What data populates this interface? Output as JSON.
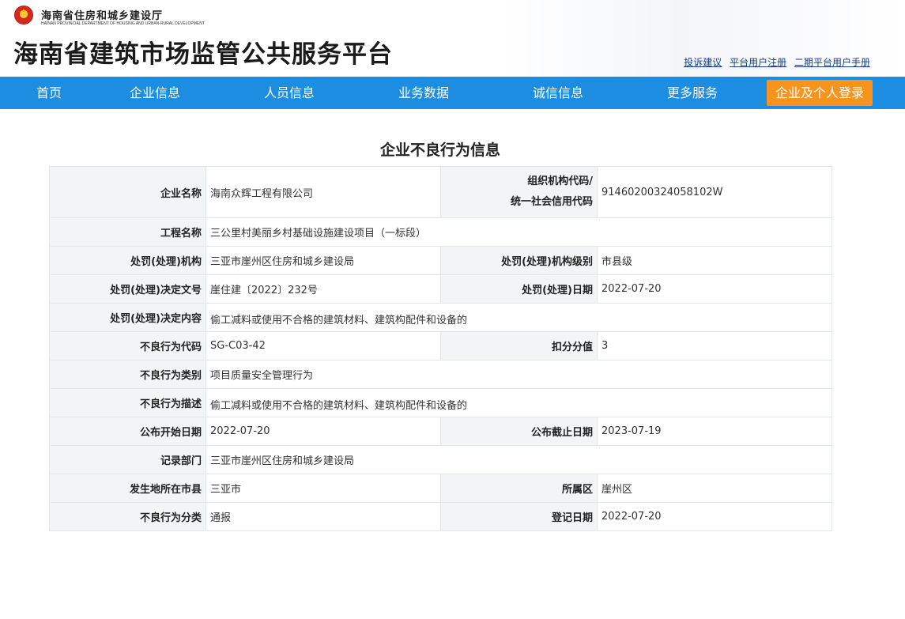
{
  "header": {
    "dept_name": "海南省住房和城乡建设厅",
    "dept_name_en": "HAINAN PROVINCIAL DEPARTMENT OF HOUSING AND URBAN-RURAL DEVELOPMENT",
    "site_title": "海南省建筑市场监管公共服务平台",
    "links": [
      "投诉建议",
      "平台用户注册",
      "二期平台用户手册"
    ]
  },
  "nav": {
    "items": [
      "首页",
      "企业信息",
      "人员信息",
      "业务数据",
      "诚信信息",
      "更多服务"
    ],
    "login": "企业及个人登录"
  },
  "page_title": "企业不良行为信息",
  "record": {
    "company_name_label": "企业名称",
    "company_name": "海南众辉工程有限公司",
    "org_code_label_1": "组织机构代码/",
    "org_code_label_2": "统一社会信用代码",
    "org_code": "91460200324058102W",
    "project_label": "工程名称",
    "project": "三公里村美丽乡村基础设施建设项目（一标段）",
    "authority_label": "处罚(处理)机构",
    "authority": "三亚市崖州区住房和城乡建设局",
    "authority_level_label": "处罚(处理)机构级别",
    "authority_level": "市县级",
    "decision_no_label": "处罚(处理)决定文号",
    "decision_no": "崖住建〔2022〕232号",
    "decision_date_label": "处罚(处理)日期",
    "decision_date": "2022-07-20",
    "decision_content_label": "处罚(处理)决定内容",
    "decision_content": "偷工减料或使用不合格的建筑材料、建筑构配件和设备的",
    "behavior_code_label": "不良行为代码",
    "behavior_code": "SG-C03-42",
    "score_label": "扣分分值",
    "score": "3",
    "behavior_type_label": "不良行为类别",
    "behavior_type": "项目质量安全管理行为",
    "behavior_desc_label": "不良行为描述",
    "behavior_desc": "偷工减料或使用不合格的建筑材料、建筑构配件和设备的",
    "publish_start_label": "公布开始日期",
    "publish_start": "2022-07-20",
    "publish_end_label": "公布截止日期",
    "publish_end": "2023-07-19",
    "record_dept_label": "记录部门",
    "record_dept": "三亚市崖州区住房和城乡建设局",
    "city_label": "发生地所在市县",
    "city": "三亚市",
    "district_label": "所属区",
    "district": "崖州区",
    "category_label": "不良行为分类",
    "category": "通报",
    "register_date_label": "登记日期",
    "register_date": "2022-07-20"
  },
  "colors": {
    "nav_bg": "#1c8de0",
    "login_bg": "#f7941d",
    "label_bg": "#f2f4f6",
    "link": "#1a3a8f"
  }
}
